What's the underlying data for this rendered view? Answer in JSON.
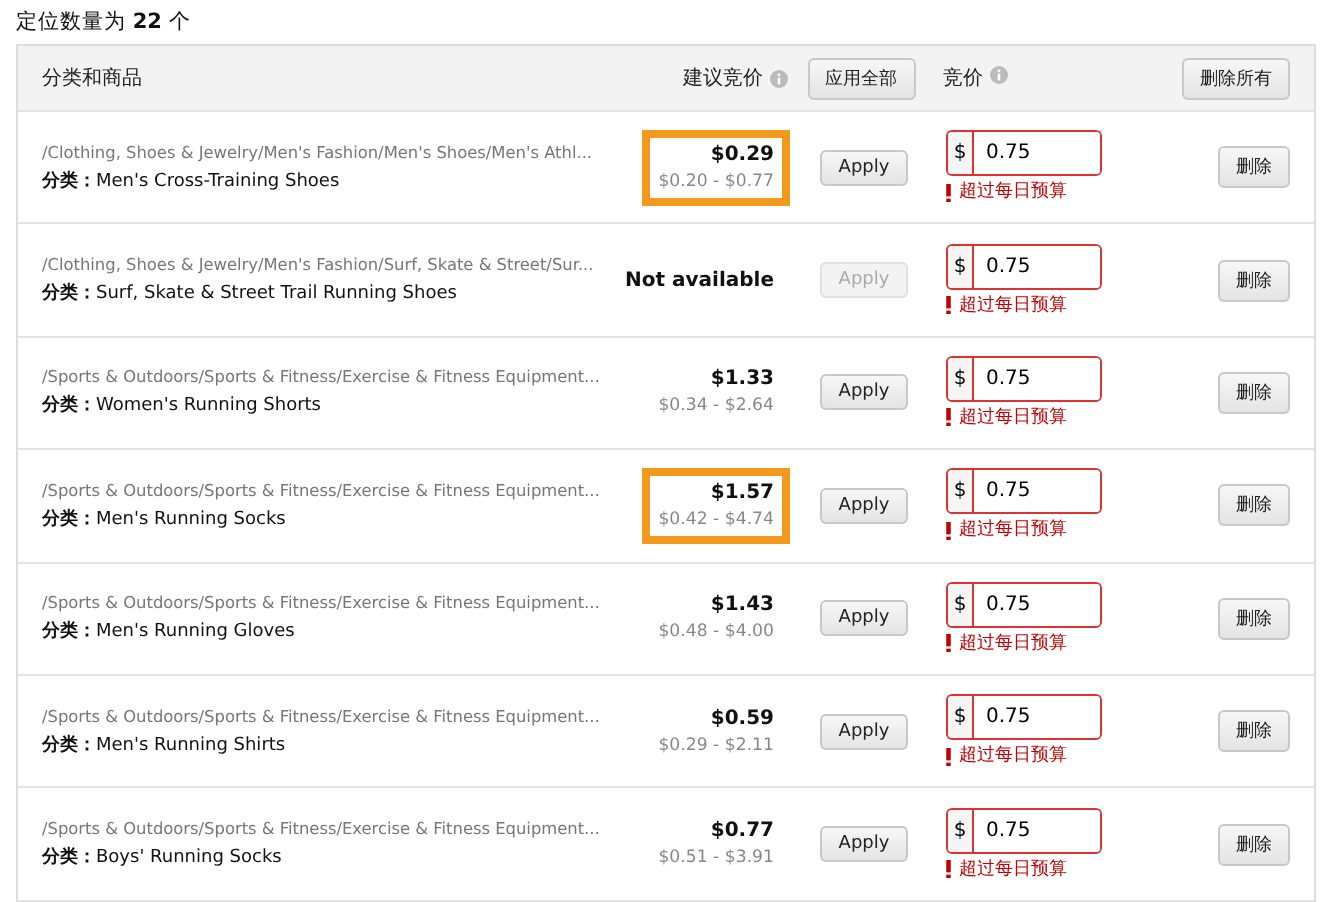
{
  "title": "定位数量为 **22** 个",
  "header": {
    "category": "分类和商品",
    "suggested": "建议竞价",
    "apply_all": "应用全部",
    "bid": "竞价",
    "delete_all": "删除所有"
  },
  "rows": [
    {
      "path": "/Clothing, Shoes & Jewelry/Men's Fashion/Men's Shoes/Men's Athl...",
      "label": "分类：",
      "name": "Men's Cross-Training Shoes",
      "price": "$0.29",
      "range": "$0.20 - $0.77",
      "highlighted": true,
      "apply": "Apply",
      "apply_disabled": false,
      "currency": "$",
      "bid": "0.75",
      "error": "超过每日预算",
      "delete": "删除"
    },
    {
      "path": "/Clothing, Shoes & Jewelry/Men's Fashion/Surf, Skate & Street/Sur...",
      "label": "分类：",
      "name": "Surf, Skate & Street Trail Running Shoes",
      "price": "Not available",
      "highlighted": false,
      "apply": "Apply",
      "apply_disabled": true,
      "currency": "$",
      "bid": "0.75",
      "error": "超过每日预算",
      "delete": "删除"
    },
    {
      "path": "/Sports & Outdoors/Sports & Fitness/Exercise & Fitness Equipment...",
      "label": "分类：",
      "name": "Women's Running Shorts",
      "price": "$1.33",
      "range": "$0.34 - $2.64",
      "highlighted": false,
      "apply": "Apply",
      "apply_disabled": false,
      "currency": "$",
      "bid": "0.75",
      "error": "超过每日预算",
      "delete": "删除"
    },
    {
      "path": "/Sports & Outdoors/Sports & Fitness/Exercise & Fitness Equipment...",
      "label": "分类：",
      "name": "Men's Running Socks",
      "price": "$1.57",
      "range": "$0.42 - $4.74",
      "highlighted": true,
      "apply": "Apply",
      "apply_disabled": false,
      "currency": "$",
      "bid": "0.75",
      "error": "超过每日预算",
      "delete": "删除"
    },
    {
      "path": "/Sports & Outdoors/Sports & Fitness/Exercise & Fitness Equipment...",
      "label": "分类：",
      "name": "Men's Running Gloves",
      "price": "$1.43",
      "range": "$0.48 - $4.00",
      "highlighted": false,
      "apply": "Apply",
      "apply_disabled": false,
      "currency": "$",
      "bid": "0.75",
      "error": "超过每日预算",
      "delete": "删除"
    },
    {
      "path": "/Sports & Outdoors/Sports & Fitness/Exercise & Fitness Equipment...",
      "label": "分类：",
      "name": "Men's Running Shirts",
      "price": "$0.59",
      "range": "$0.29 - $2.11",
      "highlighted": false,
      "apply": "Apply",
      "apply_disabled": false,
      "currency": "$",
      "bid": "0.75",
      "error": "超过每日预算",
      "delete": "删除"
    },
    {
      "path": "/Sports & Outdoors/Sports & Fitness/Exercise & Fitness Equipment...",
      "label": "分类：",
      "name": "Boys' Running Socks",
      "price": "$0.77",
      "range": "$0.51 - $3.91",
      "highlighted": false,
      "apply": "Apply",
      "apply_disabled": false,
      "currency": "$",
      "bid": "0.75",
      "error": "超过每日预算",
      "delete": "删除"
    }
  ]
}
